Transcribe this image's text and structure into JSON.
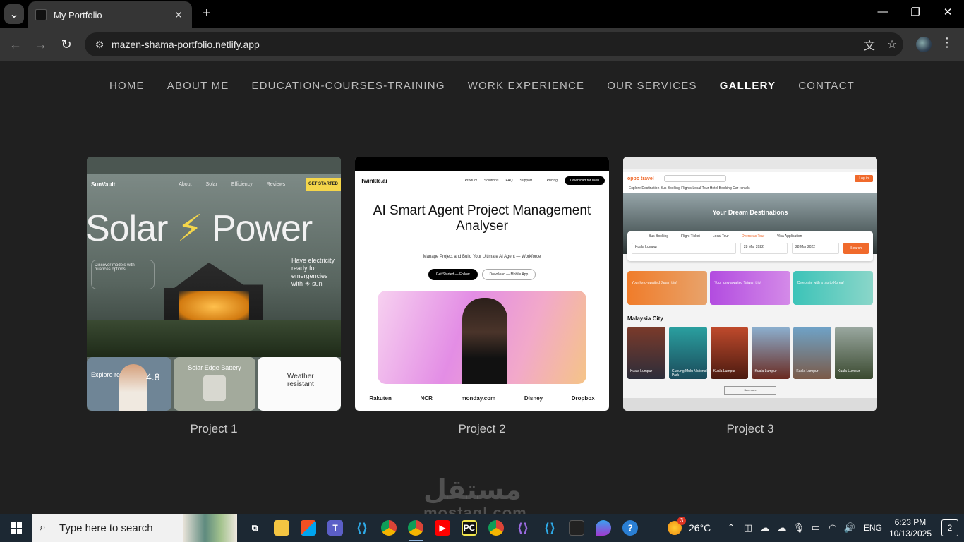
{
  "browser": {
    "tab_title": "My Portfolio",
    "tab_close": "✕",
    "new_tab": "+",
    "url": "mazen-shama-portfolio.netlify.app",
    "window_controls": {
      "minimize": "—",
      "restore": "❐",
      "close": "✕"
    }
  },
  "nav": {
    "items": [
      {
        "label": "HOME",
        "active": false
      },
      {
        "label": "ABOUT ME",
        "active": false
      },
      {
        "label": "EDUCATION-COURSES-TRAINING",
        "active": false
      },
      {
        "label": "WORK EXPERIENCE",
        "active": false
      },
      {
        "label": "OUR SERVICES",
        "active": false
      },
      {
        "label": "GALLERY",
        "active": true
      },
      {
        "label": "CONTACT",
        "active": false
      }
    ]
  },
  "gallery": {
    "projects": [
      {
        "caption": "Project 1",
        "shot": {
          "logo": "SunVault",
          "menu": [
            "About",
            "Solar",
            "Efficiency",
            "Reviews"
          ],
          "cta": "GET STARTED",
          "hero_left": "Solar",
          "hero_right": "Power",
          "side_text": "Have electricity ready for emergencies with ☀ sun",
          "info_text": "Discover models with nuances options.",
          "tile1_text": "Explore reviews",
          "tile1_rating": "4.8",
          "tile2_text": "Solar Edge Battery",
          "tile3_text": "Weather resistant"
        }
      },
      {
        "caption": "Project 2",
        "shot": {
          "logo": "Twinkle.ai",
          "menu": [
            "Product",
            "Solutions",
            "FAQ",
            "Support",
            "Pricing"
          ],
          "download": "Download for Web",
          "title": "AI Smart Agent Project Management Analyser",
          "subtitle": "Manage Project and Build Your Ultimate AI Agent — Workforce",
          "btn_primary": "Get Started — Follow",
          "btn_secondary": "Download — Mobile App",
          "logos": [
            "Rakuten",
            "NCR",
            "monday.com",
            "Disney",
            "Dropbox"
          ]
        }
      },
      {
        "caption": "Project 3",
        "shot": {
          "logo": "oppo travel",
          "login": "Log in",
          "menu": "Explore Destination   Bus Booking   Flights   Local Tour   Hotel Booking   Car rentals",
          "banner_title": "Your Dream Destinations",
          "tabs": [
            "Bus Booking",
            "Flight Ticket",
            "Local Tour",
            "Overseas Tour",
            "Visa Application"
          ],
          "destination": "Kuala Lumpur",
          "date_from": "28 Mar 2022",
          "date_to": "28 Mar 2022",
          "search": "Search",
          "promos": [
            "Your long-awaited Japan trip!",
            "Your long-awaited Taiwan trip!",
            "Celebrate with a trip to Korea!"
          ],
          "city_heading": "Malaysia City",
          "cities": [
            "Kuala Lumpur",
            "Gunung Mulu National Park",
            "Kuala Lumpur",
            "Kuala Lumpur",
            "Kuala Lumpur",
            "Kuala Lumpur"
          ],
          "see_more": "See more"
        }
      }
    ]
  },
  "watermark": {
    "arabic": "مستقل",
    "latin": "mostaql.com"
  },
  "taskbar": {
    "search_placeholder": "Type here to search",
    "weather_badge": "3",
    "temperature": "26°C",
    "language": "ENG",
    "time": "6:23 PM",
    "date": "10/13/2025",
    "notification_count": "2"
  }
}
